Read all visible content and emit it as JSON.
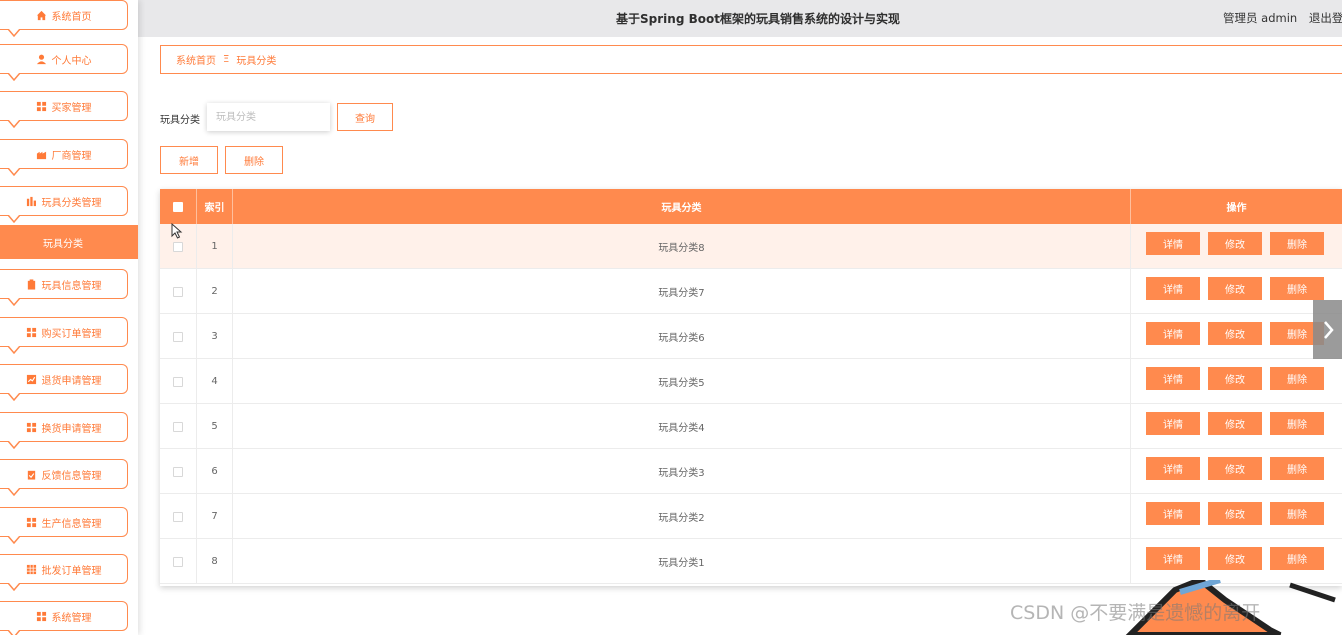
{
  "header": {
    "title": "基于Spring Boot框架的玩具销售系统的设计与实现",
    "user_role": "管理员 admin",
    "logout_label": "退出登录"
  },
  "sidebar": {
    "items": [
      {
        "label": "系统首页",
        "icon": "home-icon"
      },
      {
        "label": "个人中心",
        "icon": "user-icon"
      },
      {
        "label": "买家管理",
        "icon": "grid-icon"
      },
      {
        "label": "厂商管理",
        "icon": "factory-icon"
      },
      {
        "label": "玩具分类管理",
        "icon": "bar-chart-icon"
      },
      {
        "label": "玩具信息管理",
        "icon": "clipboard-icon"
      },
      {
        "label": "购买订单管理",
        "icon": "grid-icon"
      },
      {
        "label": "退货申请管理",
        "icon": "chart-icon"
      },
      {
        "label": "换货申请管理",
        "icon": "grid-icon"
      },
      {
        "label": "反馈信息管理",
        "icon": "clipboard-check-icon"
      },
      {
        "label": "生产信息管理",
        "icon": "grid-icon"
      },
      {
        "label": "批发订单管理",
        "icon": "table-icon"
      },
      {
        "label": "系统管理",
        "icon": "grid-icon"
      }
    ],
    "active_sub": "玩具分类"
  },
  "breadcrumb": {
    "home": "系统首页",
    "separator": "Ξ",
    "current": "玩具分类"
  },
  "search": {
    "label": "玩具分类",
    "placeholder": "玩具分类",
    "button": "查询"
  },
  "toolbar": {
    "add": "新增",
    "delete": "删除"
  },
  "table": {
    "headers": {
      "index": "索引",
      "category": "玩具分类",
      "actions": "操作"
    },
    "rows": [
      {
        "index": "1",
        "category": "玩具分类8"
      },
      {
        "index": "2",
        "category": "玩具分类7"
      },
      {
        "index": "3",
        "category": "玩具分类6"
      },
      {
        "index": "4",
        "category": "玩具分类5"
      },
      {
        "index": "5",
        "category": "玩具分类4"
      },
      {
        "index": "6",
        "category": "玩具分类3"
      },
      {
        "index": "7",
        "category": "玩具分类2"
      },
      {
        "index": "8",
        "category": "玩具分类1"
      }
    ],
    "actions": {
      "detail": "详情",
      "edit": "修改",
      "delete": "删除"
    }
  },
  "watermark": "CSDN @不要满是遗憾的离开",
  "colors": {
    "accent": "#ff8a4e",
    "header_bg": "#e8e8ea",
    "row_highlight": "#fff1ea"
  }
}
